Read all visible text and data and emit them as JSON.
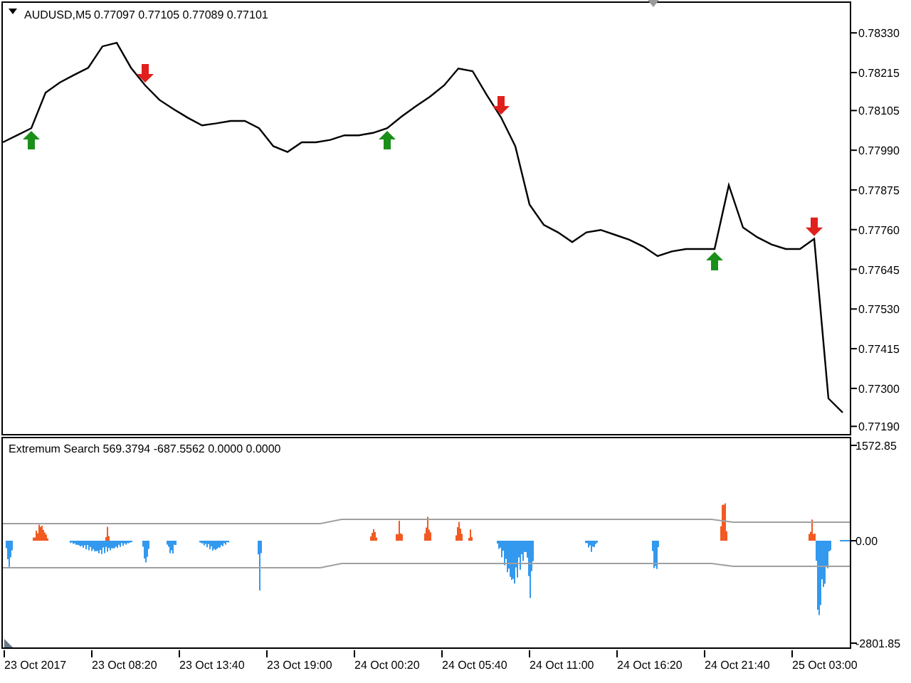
{
  "header": {
    "quotes": "0.77097 0.77105 0.77089 0.77101"
  },
  "price_chart": {
    "chart_data": {
      "type": "line",
      "categories": [
        null,
        null,
        null,
        null,
        null,
        null,
        null,
        null,
        null,
        null,
        null,
        null,
        null,
        null,
        null,
        null,
        null,
        null,
        null,
        null,
        null,
        null,
        null,
        null,
        null,
        null,
        null,
        null,
        null,
        null,
        null,
        null,
        null,
        null,
        null,
        null,
        null,
        null,
        null,
        null,
        null,
        null,
        null,
        null,
        null,
        null,
        null,
        null,
        null,
        null,
        null,
        null,
        null,
        null,
        null,
        null,
        null,
        null,
        null,
        null
      ],
      "series": [
        {
          "name": "AUDUSD,M5",
          "color": "#000000",
          "values": [
            0.78013,
            0.78033,
            0.78054,
            0.78157,
            0.78186,
            0.78208,
            0.78229,
            0.78291,
            0.78301,
            0.78229,
            0.78178,
            0.78136,
            0.78109,
            0.78084,
            0.78062,
            0.78068,
            0.78075,
            0.78075,
            0.78054,
            0.78002,
            0.77985,
            0.78013,
            0.78013,
            0.7802,
            0.78033,
            0.78033,
            0.7804,
            0.78054,
            0.78087,
            0.78117,
            0.78145,
            0.78178,
            0.78227,
            0.78219,
            0.7815,
            0.78085,
            0.78002,
            0.77833,
            0.77774,
            0.77752,
            0.77724,
            0.77752,
            0.77759,
            0.77745,
            0.77731,
            0.77711,
            0.77683,
            0.77697,
            0.77704,
            0.77704,
            0.77704,
            0.77889,
            0.77766,
            0.77738,
            0.77717,
            0.77704,
            0.77704,
            0.77733,
            0.77271,
            0.7723
          ]
        }
      ],
      "ylim": [
        0.77172,
        0.78417
      ],
      "yticks": [
        {
          "value": 0.7833,
          "label": "0.78330"
        },
        {
          "value": 0.78215,
          "label": "0.78215"
        },
        {
          "value": 0.78105,
          "label": "0.78105"
        },
        {
          "value": 0.7799,
          "label": "0.77990"
        },
        {
          "value": 0.77875,
          "label": "0.77875"
        },
        {
          "value": 0.7776,
          "label": "0.77760"
        },
        {
          "value": 0.77645,
          "label": "0.77645"
        },
        {
          "value": 0.7753,
          "label": "0.77530"
        },
        {
          "value": 0.77415,
          "label": "0.77415"
        },
        {
          "value": 0.773,
          "label": "0.77300"
        },
        {
          "value": 0.7719,
          "label": "0.77190"
        }
      ]
    },
    "signals": [
      {
        "kind": "buy"
      },
      {
        "kind": "sell"
      },
      {
        "kind": "buy"
      },
      {
        "kind": "sell"
      },
      {
        "kind": "buy"
      },
      {
        "kind": "sell"
      }
    ]
  },
  "time_axis": {
    "labels": [
      "23 Oct 2017",
      "23 Oct 08:20",
      "23 Oct 13:40",
      "23 Oct 19:00",
      "24 Oct 00:20",
      "24 Oct 05:40",
      "24 Oct 11:00",
      "24 Oct 16:20",
      "24 Oct 21:40",
      "25 Oct 03:00"
    ]
  },
  "indicator": {
    "label": "Extremum Search 569.3794 -687.5562 0.0000 0.0000",
    "scale_labels": [
      "1572.85",
      "0.00",
      "-2801.85"
    ]
  }
}
